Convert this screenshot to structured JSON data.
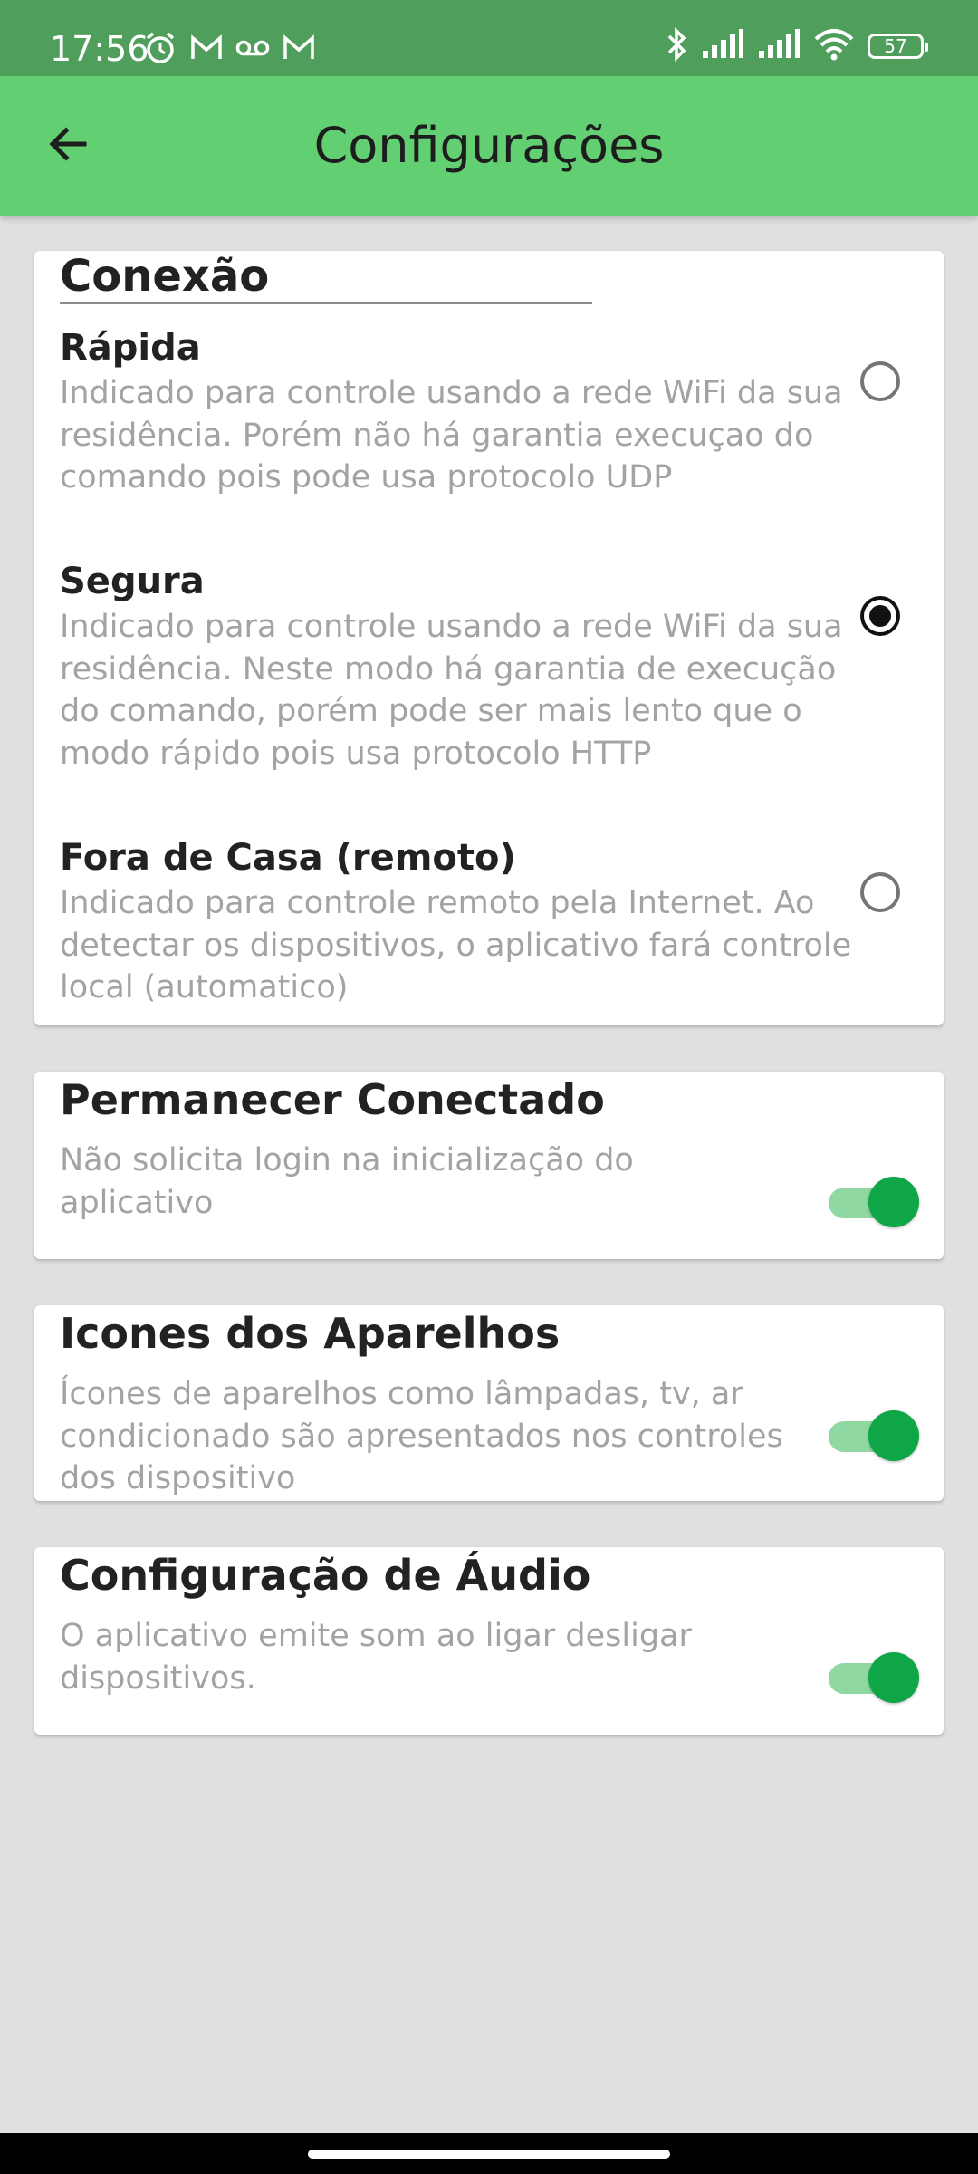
{
  "status_bar": {
    "time": "17:56",
    "battery": "57",
    "left_icons": [
      "alarm-icon",
      "gmail-icon",
      "voicemail-icon",
      "gmail-icon"
    ],
    "right_icons": [
      "bluetooth-icon",
      "signal-icon",
      "signal-icon",
      "wifi-icon",
      "battery-icon"
    ]
  },
  "app_bar": {
    "title": "Configurações",
    "back_icon": "arrow-left-icon"
  },
  "connection": {
    "title": "Conexão",
    "options": [
      {
        "title": "Rápida",
        "description": "Indicado para controle usando a rede WiFi da sua residência. Porém não há garantia execuçao do comando pois pode usa protocolo UDP",
        "selected": false
      },
      {
        "title": "Segura",
        "description": "Indicado para controle usando a rede WiFi da sua residência. Neste modo há garantia de execução do comando, porém pode ser mais lento que o modo rápido pois usa protocolo HTTP",
        "selected": true
      },
      {
        "title": "Fora de Casa (remoto)",
        "description": "Indicado para controle remoto pela Internet. Ao detectar os dispositivos, o aplicativo fará controle local (automatico)",
        "selected": false
      }
    ]
  },
  "settings": [
    {
      "title": "Permanecer Conectado",
      "description": "Não solicita login na inicialização do aplicativo",
      "enabled": true
    },
    {
      "title": "Icones dos Aparelhos",
      "description": "Ícones de aparelhos como lâmpadas, tv, ar condicionado são apresentados nos controles dos dispositivo",
      "enabled": true
    },
    {
      "title": "Configuração de Áudio",
      "description": "O aplicativo emite som ao ligar desligar dispositivos.",
      "enabled": true
    }
  ],
  "colors": {
    "status_bar": "#4f9e5b",
    "app_bar": "#62cf72",
    "background": "#e0e0e0",
    "toggle_on": "#0ea646",
    "toggle_track": "#8fd8a2"
  }
}
